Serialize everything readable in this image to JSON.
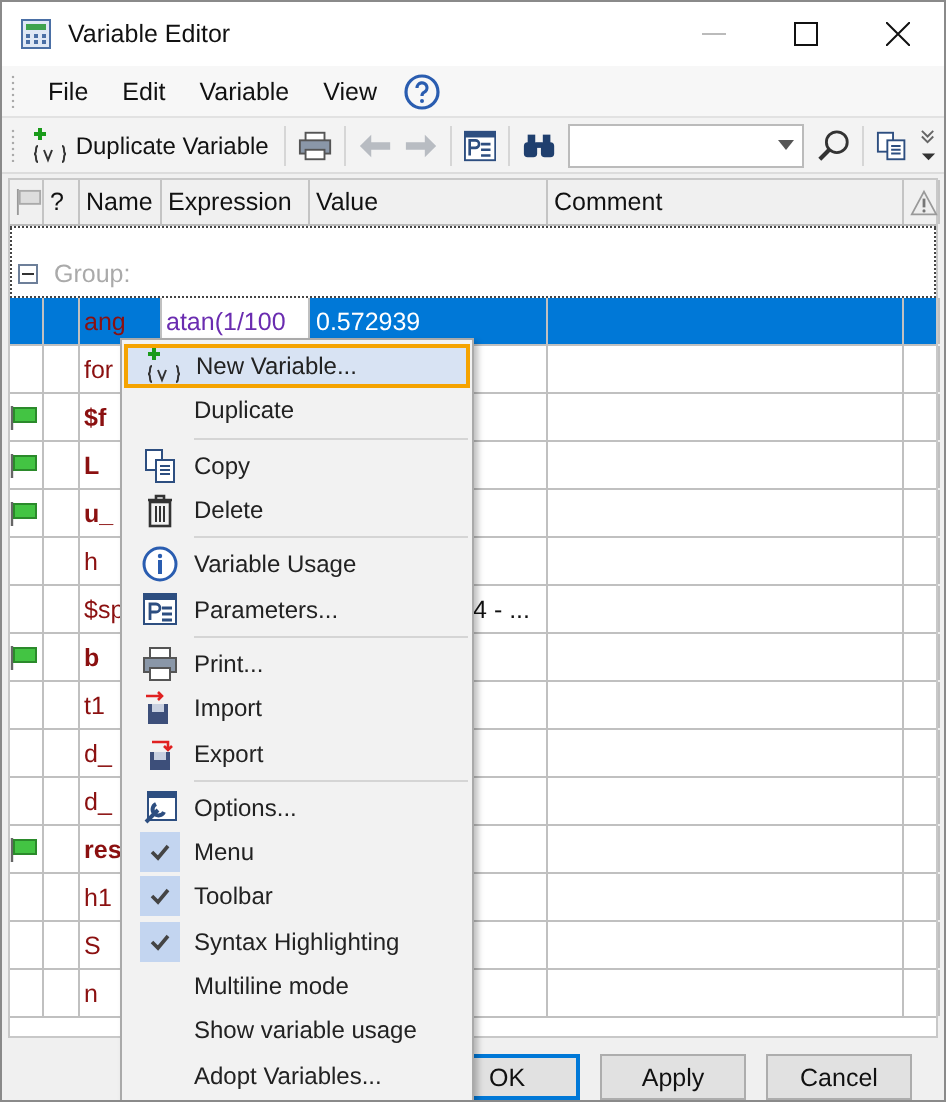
{
  "window": {
    "title": "Variable Editor"
  },
  "menubar": [
    "File",
    "Edit",
    "Variable",
    "View"
  ],
  "toolbar": {
    "duplicate_button": "Duplicate Variable"
  },
  "table": {
    "columns": [
      "?",
      "Name",
      "Expression",
      "Value",
      "Comment"
    ],
    "group": "Group:",
    "rows": [
      {
        "name": "ang",
        "expression": "atan(1/100",
        "value": "0.572939",
        "flag": false,
        "bold": false,
        "selected": true
      },
      {
        "name": "for",
        "flag": false,
        "bold": false,
        "selected": false
      },
      {
        "name": "$f",
        "flag": true,
        "bold": true,
        "selected": false
      },
      {
        "name": "L",
        "flag": true,
        "bold": true,
        "selected": false
      },
      {
        "name": "u_",
        "flag": true,
        "bold": true,
        "selected": false
      },
      {
        "name": "h",
        "flag": false,
        "bold": false,
        "selected": false
      },
      {
        "name": "$sp",
        "value": "4 - ...",
        "flag": false,
        "bold": false,
        "selected": false
      },
      {
        "name": "b",
        "flag": true,
        "bold": true,
        "selected": false
      },
      {
        "name": "t1",
        "flag": false,
        "bold": false,
        "selected": false
      },
      {
        "name": "d_",
        "flag": false,
        "bold": false,
        "selected": false
      },
      {
        "name": "d_",
        "flag": false,
        "bold": false,
        "selected": false
      },
      {
        "name": "res",
        "flag": true,
        "bold": true,
        "selected": false
      },
      {
        "name": "h1",
        "flag": false,
        "bold": false,
        "selected": false
      },
      {
        "name": "S",
        "flag": false,
        "bold": false,
        "selected": false
      },
      {
        "name": "n",
        "flag": false,
        "bold": false,
        "selected": false
      }
    ]
  },
  "context_menu": [
    {
      "kind": "item",
      "label": "New Variable...",
      "selected": true
    },
    {
      "kind": "item",
      "label": "Duplicate",
      "selected": false
    },
    {
      "kind": "separator"
    },
    {
      "kind": "item",
      "label": "Copy",
      "selected": false
    },
    {
      "kind": "item",
      "label": "Delete",
      "selected": false
    },
    {
      "kind": "separator"
    },
    {
      "kind": "item",
      "label": "Variable Usage",
      "selected": false
    },
    {
      "kind": "item",
      "label": "Parameters...",
      "selected": false
    },
    {
      "kind": "separator"
    },
    {
      "kind": "item",
      "label": "Print...",
      "selected": false
    },
    {
      "kind": "item",
      "label": "Import",
      "selected": false
    },
    {
      "kind": "item",
      "label": "Export",
      "selected": false
    },
    {
      "kind": "separator"
    },
    {
      "kind": "item",
      "label": "Options...",
      "selected": false
    },
    {
      "kind": "check",
      "label": "Menu",
      "checked": true,
      "selected": false
    },
    {
      "kind": "check",
      "label": "Toolbar",
      "checked": true,
      "selected": false
    },
    {
      "kind": "check",
      "label": "Syntax Highlighting",
      "checked": true,
      "selected": false
    },
    {
      "kind": "check",
      "label": "Multiline mode",
      "checked": false,
      "selected": false
    },
    {
      "kind": "check",
      "label": "Show variable usage",
      "checked": false,
      "selected": false
    },
    {
      "kind": "item",
      "label": "Adopt Variables...",
      "selected": false
    }
  ],
  "buttons": [
    {
      "label": "OK",
      "selected": true
    },
    {
      "label": "Apply",
      "selected": false
    },
    {
      "label": "Cancel",
      "selected": false
    }
  ]
}
